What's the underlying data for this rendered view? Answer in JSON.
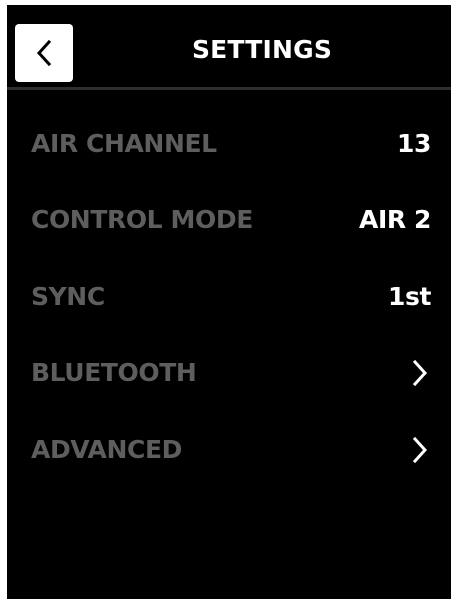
{
  "header": {
    "title": "SETTINGS",
    "back_icon": "chevron-left-icon"
  },
  "settings": [
    {
      "label": "AIR CHANNEL",
      "value": "13"
    },
    {
      "label": "CONTROL MODE",
      "value": "AIR 2"
    },
    {
      "label": "SYNC",
      "value": "1st"
    },
    {
      "label": "BLUETOOTH",
      "icon": "chevron-right-icon"
    },
    {
      "label": "ADVANCED",
      "icon": "chevron-right-icon"
    }
  ],
  "colors": {
    "background": "#000000",
    "label": "#5e5e5e",
    "value": "#ffffff",
    "divider": "#2e2e2e"
  }
}
